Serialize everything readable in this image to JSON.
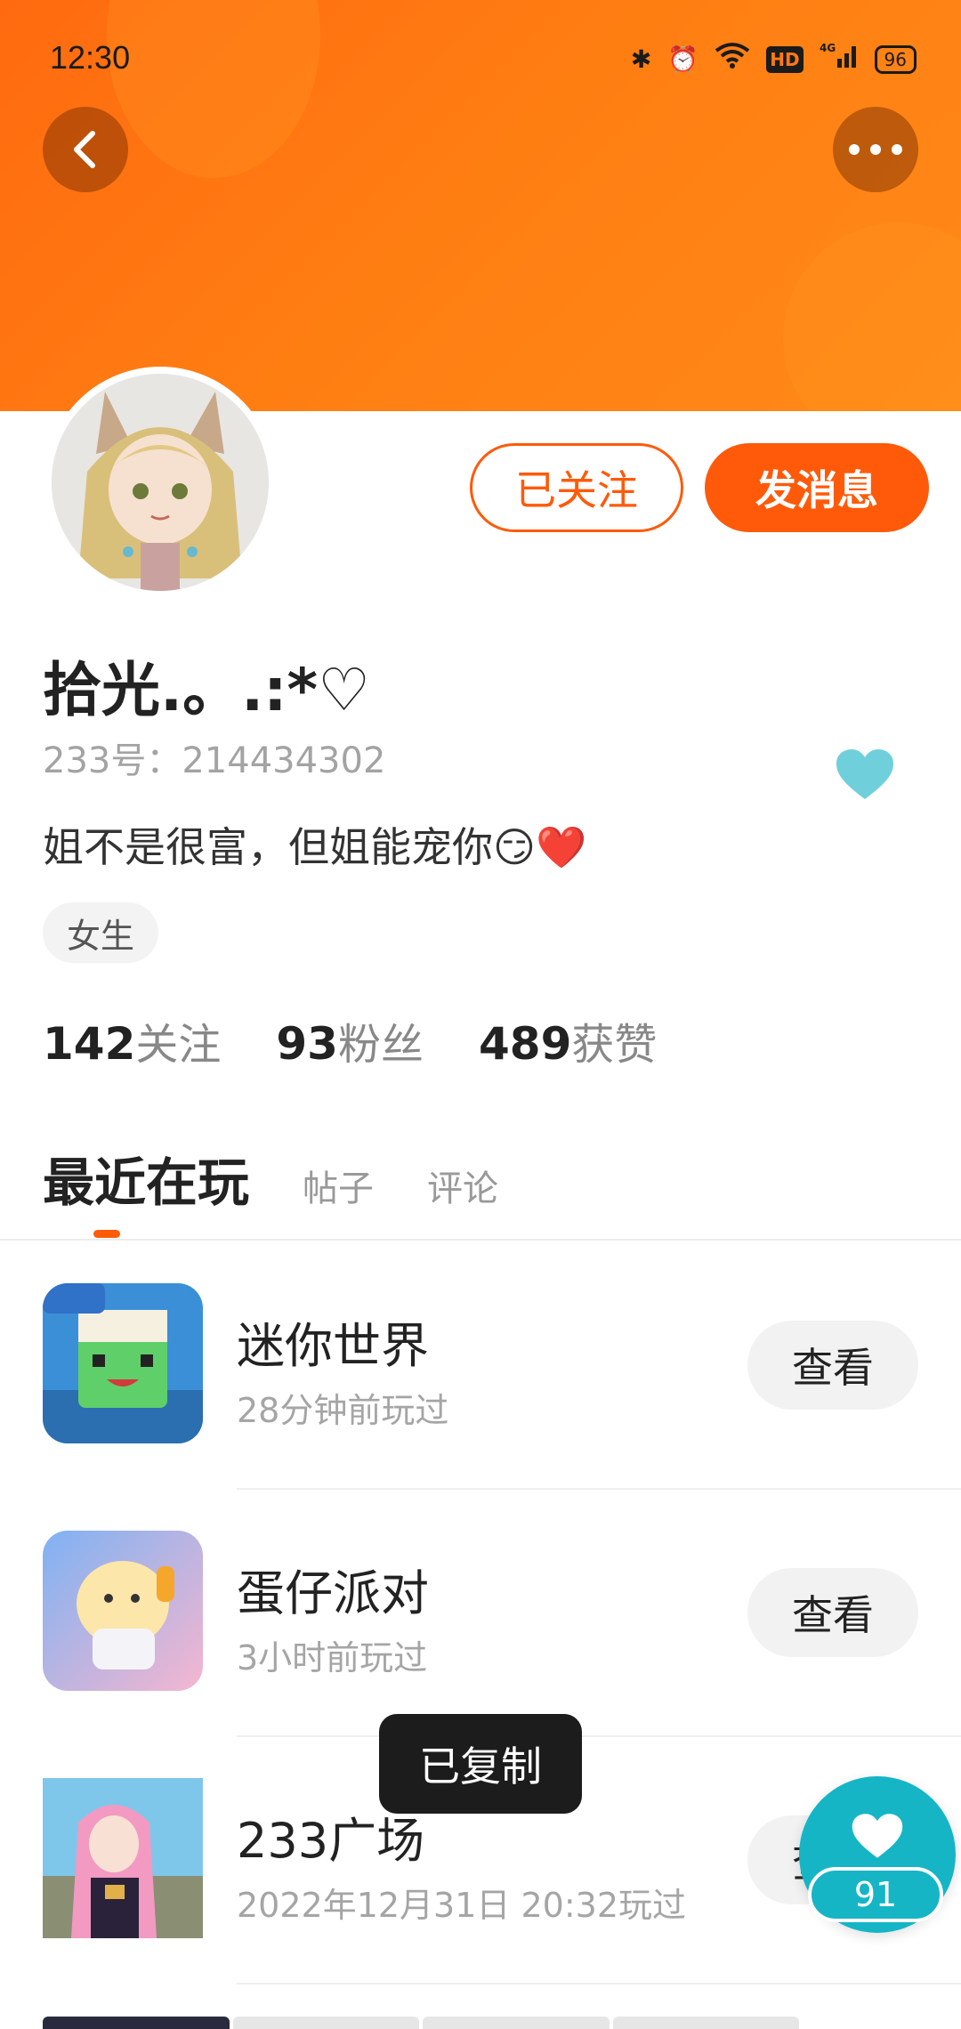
{
  "status_bar": {
    "time": "12:30",
    "network": "4G",
    "hd_label": "HD",
    "battery": "96"
  },
  "profile": {
    "username": "拾光.。.:*♡",
    "id_label": "233号：214434302",
    "bio": "姐不是很富，但姐能宠你😏❤️",
    "gender_tag": "女生",
    "follow_button": "已关注",
    "message_button": "发消息",
    "stats": [
      {
        "num": "142",
        "label": "关注"
      },
      {
        "num": "93",
        "label": "粉丝"
      },
      {
        "num": "489",
        "label": "获赞"
      }
    ]
  },
  "tabs": [
    {
      "label": "最近在玩",
      "active": true
    },
    {
      "label": "帖子",
      "active": false
    },
    {
      "label": "评论",
      "active": false
    }
  ],
  "games": [
    {
      "name": "迷你世界",
      "played": "28分钟前玩过",
      "button": "查看",
      "icon": "mini-world-icon"
    },
    {
      "name": "蛋仔派对",
      "played": "3小时前玩过",
      "button": "查看",
      "icon": "eggy-party-icon"
    },
    {
      "name": "233广场",
      "played": "2022年12月31日 20:32玩过",
      "button": "查看",
      "icon": "233-plaza-icon"
    }
  ],
  "toast": "已复制",
  "float_like": {
    "count": "91"
  },
  "colors": {
    "accent": "#ff5a0a",
    "header": "#ff7a14",
    "like": "#15b5c6"
  }
}
